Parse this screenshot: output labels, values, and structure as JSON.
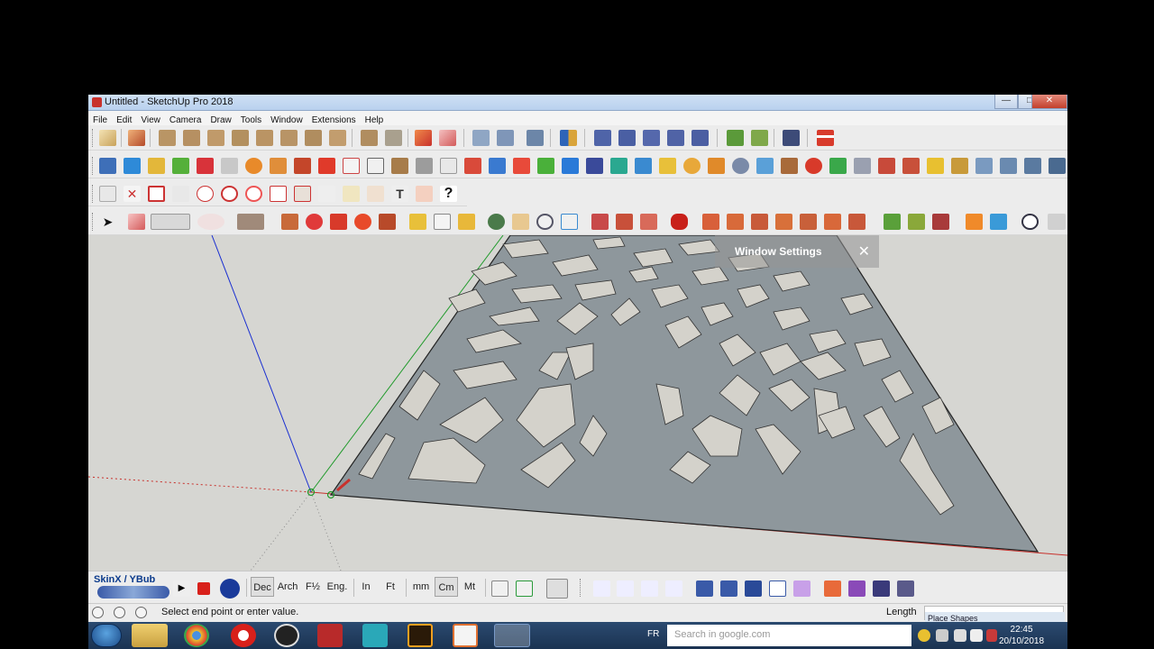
{
  "window": {
    "title": "Untitled - SketchUp Pro 2018",
    "min_glyph": "—",
    "max_glyph": "□",
    "close_glyph": "✕"
  },
  "menu": [
    "File",
    "Edit",
    "View",
    "Camera",
    "Draw",
    "Tools",
    "Window",
    "Extensions",
    "Help"
  ],
  "tooltip": {
    "text": "Window Settings",
    "close": "✕"
  },
  "units_toolbar": {
    "skin_label": "SkinX / YBub",
    "buttons": [
      "Dec",
      "Arch",
      "F½",
      "Eng.",
      "In",
      "Ft",
      "mm",
      "Cm",
      "Mt"
    ],
    "selected": [
      "Dec",
      "Cm"
    ]
  },
  "status": {
    "text": "Select end point or enter value.",
    "measure_label": "Length",
    "panel_title": "Place Shapes"
  },
  "taskbar": {
    "search_placeholder": "Search in google.com",
    "language": "FR",
    "time": "22:45",
    "date": "20/10/2018"
  },
  "colors": {
    "accent_red": "#c8312c",
    "ground": "#d6d6d2",
    "panel_face": "#8e979c",
    "hole": "#d4d2cb",
    "axis_blue": "#1a2fd1",
    "axis_green": "#1f9a2a",
    "axis_red": "#c8312c"
  },
  "icons": {
    "pencil": "pencil-icon",
    "select": "select-arrow-icon",
    "eraser": "eraser-icon",
    "help": "help-icon",
    "play": "play-icon",
    "stop": "stop-icon"
  }
}
